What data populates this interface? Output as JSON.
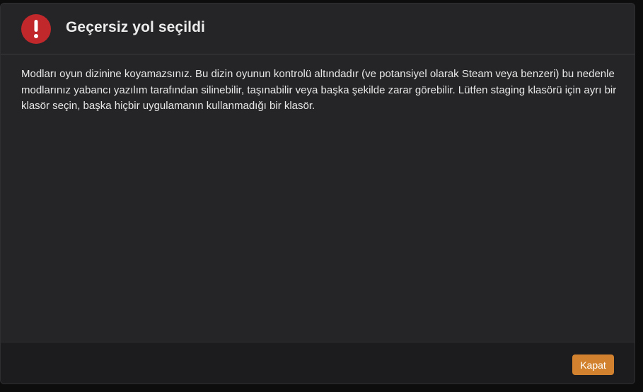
{
  "dialog": {
    "title": "Geçersiz yol seçildi",
    "icon": "exclamation-circle-icon",
    "message": "Modları oyun dizinine koyamazsınız. Bu dizin oyunun kontrolü altındadır (ve potansiyel olarak Steam veya benzeri) bu nedenle modlarınız yabancı yazılım tarafından silinebilir, taşınabilir veya başka şekilde zarar görebilir. Lütfen staging klasörü için ayrı bir klasör seçin, başka hiçbir uygulamanın kullanmadığı bir klasör.",
    "close_label": "Kapat"
  },
  "colors": {
    "dialog_background": "#252527",
    "footer_background": "#1c1c1e",
    "alert_red": "#c0282c",
    "accent_orange": "#d2822e",
    "text": "#e8e8e8"
  }
}
